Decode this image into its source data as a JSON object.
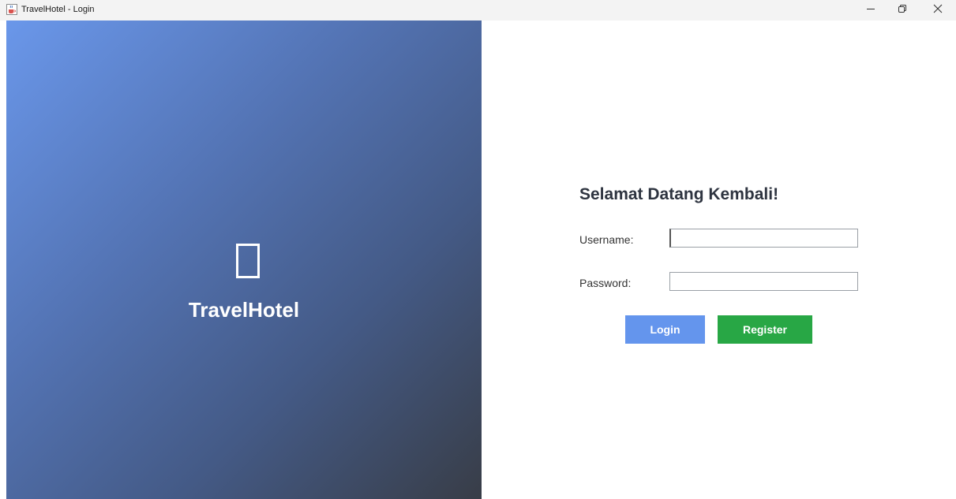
{
  "window": {
    "title": "TravelHotel - Login",
    "app_icon": "java-cup-icon",
    "controls": [
      "minimize-icon",
      "restore-icon",
      "close-icon"
    ]
  },
  "left_panel": {
    "logo_icon": "missing-glyph-icon",
    "brand_name": "TravelHotel",
    "gradient": [
      "#6a97ea",
      "#383d47"
    ]
  },
  "form": {
    "heading": "Selamat Datang Kembali!",
    "username_label": "Username:",
    "username_value": "",
    "password_label": "Password:",
    "password_value": "",
    "login_label": "Login",
    "register_label": "Register"
  },
  "colors": {
    "login_button": "#6495ed",
    "register_button": "#28a745",
    "heading_text": "#2e3440"
  }
}
